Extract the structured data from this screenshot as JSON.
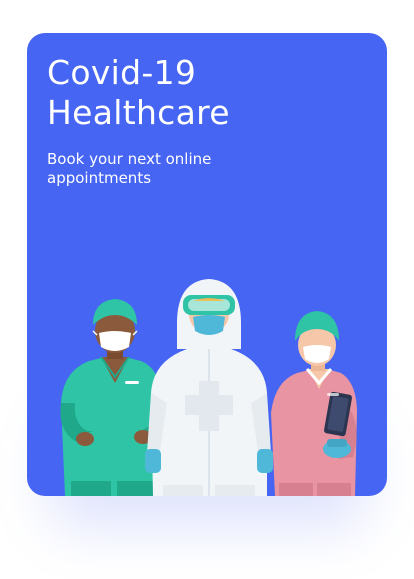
{
  "card": {
    "title_line1": "Covid-19",
    "title_line2": "Healthcare",
    "subtitle": "Book your next online appointments",
    "background_color": "#4565F2"
  },
  "illustration": {
    "icons": [
      "doctor-left-icon",
      "hazmat-worker-icon",
      "nurse-right-icon"
    ],
    "colors": {
      "scrubs_green": "#2EC4A5",
      "scrubs_green_dark": "#1FA88A",
      "hazmat_white": "#F2F5F8",
      "nurse_pink": "#E994A2",
      "skin_dark": "#8B5A3C",
      "skin_light": "#F6C7A8",
      "glove_blue": "#4FB8D8"
    }
  }
}
